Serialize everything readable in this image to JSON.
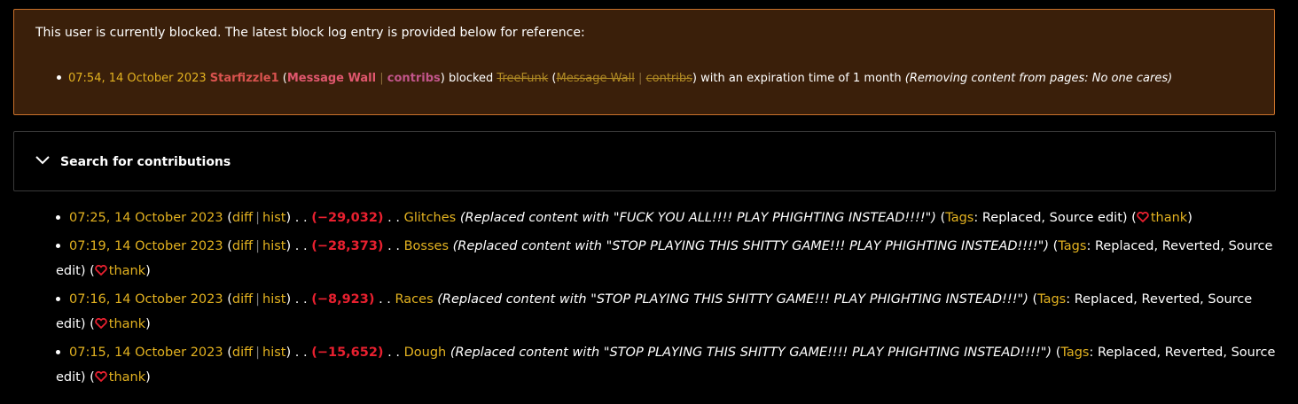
{
  "block_notice": {
    "text": "This user is currently blocked. The latest block log entry is provided below for reference:",
    "entry": {
      "timestamp": "07:54, 14 October 2023",
      "blocker": "Starfizzle1",
      "message_wall": "Message Wall",
      "contribs": "contribs",
      "blocked_word": "blocked",
      "target": "TreeFunk",
      "target_message_wall": "Message Wall",
      "target_contribs": "contribs",
      "expiry_text": "with an expiration time of 1 month",
      "reason": "(Removing content from pages: No one cares)"
    }
  },
  "search": {
    "title": "Search for contributions",
    "icon": "chevron-down-icon"
  },
  "labels": {
    "diff": "diff",
    "hist": "hist",
    "tags": "Tags",
    "thank": "thank",
    "dots": ". ."
  },
  "contributions": [
    {
      "timestamp": "07:25, 14 October 2023",
      "size": "(−29,032)",
      "page": "Glitches",
      "summary": "(Replaced content with \"FUCK YOU ALL!!!! PLAY PHIGHTING INSTEAD!!!!\")",
      "tags": "Replaced, Source edit"
    },
    {
      "timestamp": "07:19, 14 October 2023",
      "size": "(−28,373)",
      "page": "Bosses",
      "summary": "(Replaced content with \"STOP PLAYING THIS SHITTY GAME!!! PLAY PHIGHTING INSTEAD!!!!\")",
      "tags": "Replaced, Reverted, Source edit"
    },
    {
      "timestamp": "07:16, 14 October 2023",
      "size": "(−8,923)",
      "page": "Races",
      "summary": "(Replaced content with \"STOP PLAYING THIS SHITTY GAME!!! PLAY PHIGHTING INSTEAD!!!\")",
      "tags": "Replaced, Reverted, Source edit"
    },
    {
      "timestamp": "07:15, 14 October 2023",
      "size": "(−15,652)",
      "page": "Dough",
      "summary": "(Replaced content with \"STOP PLAYING THIS SHITTY GAME!!!! PLAY PHIGHTING INSTEAD!!!!\")",
      "tags": "Replaced, Reverted, Source edit"
    }
  ],
  "colors": {
    "link": "#e3b220",
    "negative": "#e8202f",
    "notice_bg": "#3a1f0a",
    "notice_border": "#c8702a"
  }
}
